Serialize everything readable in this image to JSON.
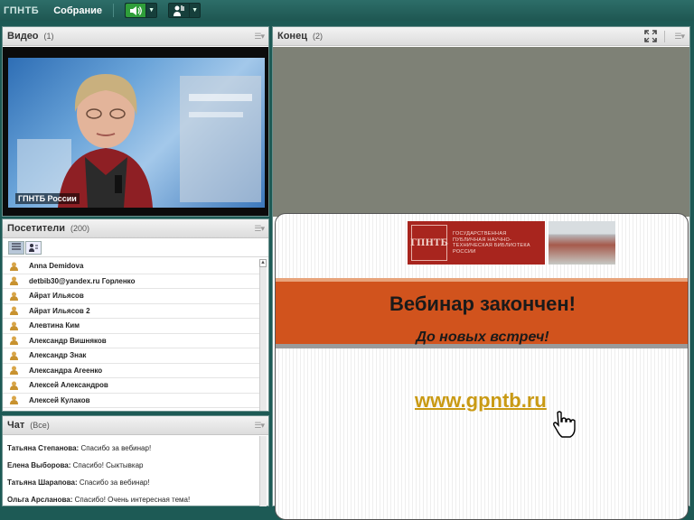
{
  "topbar": {
    "logo": "ГПНТБ",
    "meeting_menu": "Собрание",
    "speaker_icon": "speaker-icon",
    "presenter_icon": "raise-hand-icon"
  },
  "video_pod": {
    "title": "Видео",
    "count": "(1)",
    "caption": "ГПНТБ России"
  },
  "attendees_pod": {
    "title": "Посетители",
    "count": "(200)",
    "attendees": [
      "Anna Demidova",
      "detbib30@yandex.ru Горленко",
      "Айрат Ильясов",
      "Айрат Ильясов 2",
      "Алевтина Ким",
      "Александр Вишняков",
      "Александр Знак",
      "Александра Агеенко",
      "Алексей Александров",
      "Алексей Кулаков"
    ]
  },
  "chat_pod": {
    "title": "Чат",
    "scope": "(Все)",
    "messages": [
      {
        "author": "Татьяна Степанова:",
        "text": " Спасибо за вебинар!"
      },
      {
        "author": "Елена Выборова:",
        "text": " Спасибо! Сыктывкар"
      },
      {
        "author": "Татьяна Шарапова:",
        "text": " Спасибо за вебинар!"
      },
      {
        "author": "Ольга Арсланова:",
        "text": " Спасибо! Очень интересная тема!"
      }
    ]
  },
  "share_pod": {
    "title": "Конец",
    "count": "(2)",
    "slide": {
      "logo_mark": "ГПНТБ",
      "logo_text": "ГОСУДАРСТВЕННАЯ ПУБЛИЧНАЯ НАУЧНО-ТЕХНИЧЕСКАЯ БИБЛИОТЕКА РОССИИ",
      "headline": "Вебинар закончен!",
      "subline": "До новых встреч!",
      "url": "www.gpntb.ru"
    }
  },
  "colors": {
    "topbar": "#1e5752",
    "slide_band": "#d1531d",
    "url": "#c99a14",
    "speaker_active": "#2f9e3a"
  }
}
